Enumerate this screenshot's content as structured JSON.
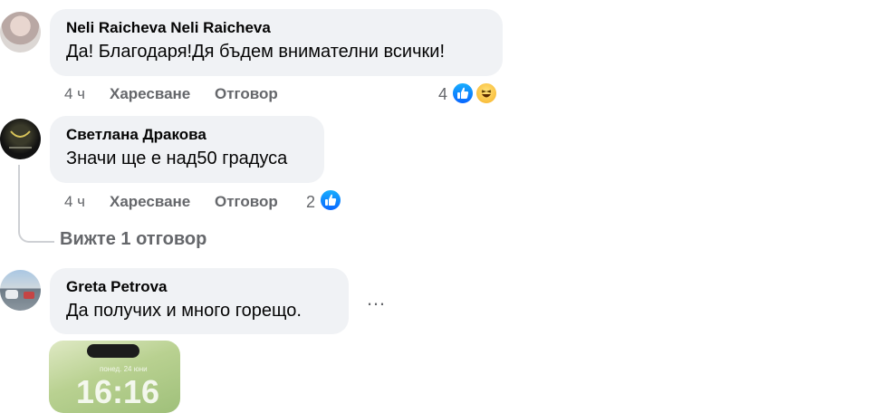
{
  "comments": [
    {
      "author": "Neli Raicheva Neli Raicheva",
      "text": "Да! Благодаря!Дя бъдем внимателни всички!",
      "time": "4 ч",
      "like_label": "Харесване",
      "reply_label": "Отговор",
      "reactions_count": "4",
      "reactions": [
        "like-icon",
        "haha-icon"
      ]
    },
    {
      "author": "Светлана Дракова",
      "text": "Значи ще е над50 градуса",
      "time": "4 ч",
      "like_label": "Харесване",
      "reply_label": "Отговор",
      "reactions_count": "2",
      "reactions": [
        "like-icon"
      ]
    },
    {
      "author": "Greta Petrova",
      "text": "Да получих и много горещо.",
      "more_label": "…",
      "attachment": {
        "clock": "16:16",
        "date": "понед. 24 юни"
      }
    }
  ],
  "view_replies_label": "Вижте 1 отговор",
  "colors": {
    "bubble": "#f0f2f5",
    "meta": "#65676b",
    "like": "#0866ff",
    "haha": "#f7b125"
  }
}
